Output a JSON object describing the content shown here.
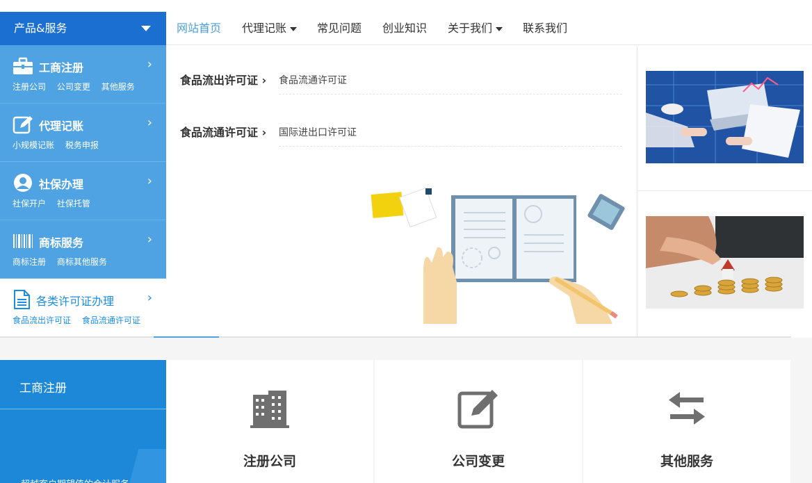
{
  "sidebar": {
    "header": "产品&服务",
    "items": [
      {
        "title": "工商注册",
        "icon": "briefcase-icon",
        "subs": [
          "注册公司",
          "公司变更",
          "其他服务"
        ]
      },
      {
        "title": "代理记账",
        "icon": "edit-icon",
        "subs": [
          "小规模记账",
          "税务申报"
        ]
      },
      {
        "title": "社保办理",
        "icon": "user-circle-icon",
        "subs": [
          "社保开户",
          "社保托管"
        ]
      },
      {
        "title": "商标服务",
        "icon": "barcode-icon",
        "subs": [
          "商标注册",
          "商标其他服务"
        ]
      },
      {
        "title": "各类许可证办理",
        "icon": "document-icon",
        "subs": [
          "食品流出许可证",
          "食品流通许可证"
        ]
      }
    ]
  },
  "nav": {
    "items": [
      "网站首页",
      "代理记账",
      "常见问题",
      "创业知识",
      "关于我们",
      "联系我们"
    ]
  },
  "permits": [
    {
      "title": "食品流出许可证",
      "link": "食品流通许可证"
    },
    {
      "title": "食品流通许可证",
      "link": "国际进出口许可证"
    }
  ],
  "lower": {
    "box_title": "工商注册",
    "box_text": "超越客户期望值的会计服务"
  },
  "services": [
    "注册公司",
    "公司变更",
    "其他服务"
  ],
  "colors": {
    "header_blue": "#1b6fd0",
    "sidebar_blue": "#4fa3e2",
    "accent": "#4a9fe0",
    "lower_blue": "#1e88d8"
  }
}
